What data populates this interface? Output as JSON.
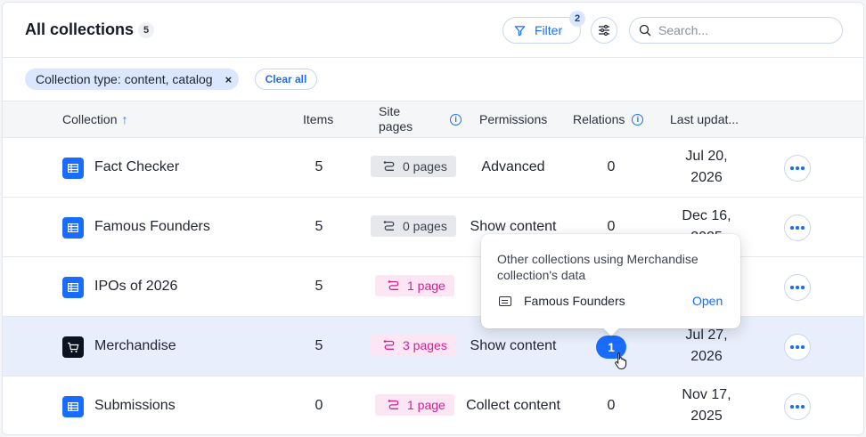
{
  "header": {
    "title": "All collections",
    "count": "5",
    "filter_label": "Filter",
    "filter_count": "2",
    "search_placeholder": "Search..."
  },
  "filters": {
    "chip_key": "Collection type:",
    "chip_value": "content, catalog",
    "chip_close": "×",
    "clear_all": "Clear all"
  },
  "table": {
    "columns": {
      "collection": "Collection",
      "sort_arrow": "↑",
      "items": "Items",
      "site_pages_1": "Site",
      "site_pages_2": "pages",
      "permissions": "Permissions",
      "relations": "Relations",
      "last_updated": "Last updat..."
    },
    "rows": [
      {
        "name": "Fact Checker",
        "items": "5",
        "pages": "0 pages",
        "permissions": "Advanced",
        "relations": "0",
        "date_1": "Jul 20,",
        "date_2": "2026"
      },
      {
        "name": "Famous Founders",
        "items": "5",
        "pages": "0 pages",
        "permissions": "Show content",
        "relations": "0",
        "date_1": "Dec 16,",
        "date_2": "2025"
      },
      {
        "name": "IPOs of 2026",
        "items": "5",
        "pages": "1 page",
        "permissions": "",
        "relations": "",
        "date_1": "",
        "date_2": ""
      },
      {
        "name": "Merchandise",
        "items": "5",
        "pages": "3 pages",
        "permissions": "Show content",
        "relations": "1",
        "date_1": "Jul 27,",
        "date_2": "2026"
      },
      {
        "name": "Submissions",
        "items": "0",
        "pages": "1 page",
        "permissions": "Collect content",
        "relations": "0",
        "date_1": "Nov 17,",
        "date_2": "2025"
      }
    ]
  },
  "popover": {
    "description": "Other collections using Merchandise collection's data",
    "item": "Famous Founders",
    "open_label": "Open"
  },
  "icons": {
    "filter": "funnel-icon",
    "settings": "sliders-icon",
    "search": "search-icon",
    "collection": "table-icon",
    "store": "cart-icon",
    "pages": "route-icon",
    "info": "info-icon",
    "more": "more-icon",
    "cursor": "hand-cursor-icon"
  },
  "colors": {
    "accent": "#1a6cff",
    "pink": "#d61f92",
    "highlight": "#e8eefb"
  }
}
